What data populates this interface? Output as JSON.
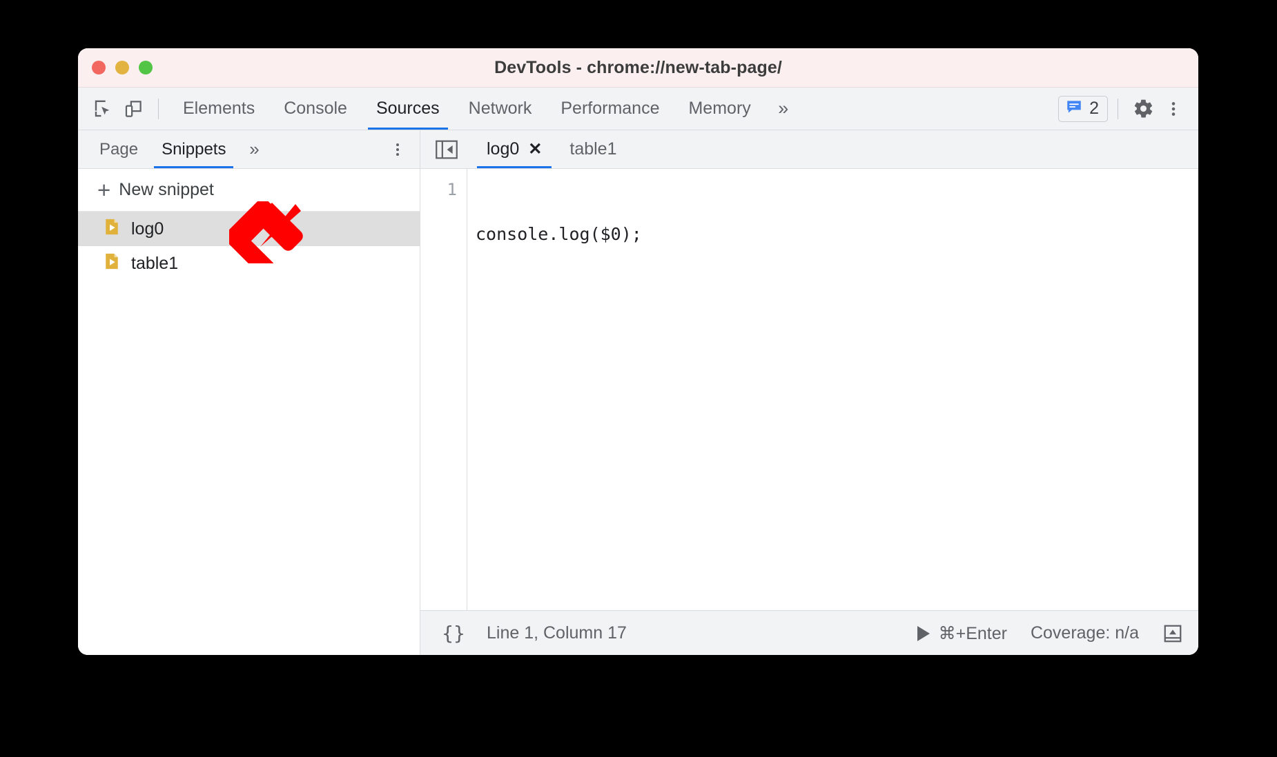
{
  "window": {
    "title": "DevTools - chrome://new-tab-page/",
    "traffic_lights": [
      {
        "name": "close",
        "color": "#f2675f"
      },
      {
        "name": "minimize",
        "color": "#e3b341"
      },
      {
        "name": "zoom",
        "color": "#53c546"
      }
    ]
  },
  "toolbar": {
    "inspect_icon": "inspect-element-icon",
    "device_icon": "device-toolbar-icon",
    "tabs": [
      {
        "label": "Elements",
        "active": false
      },
      {
        "label": "Console",
        "active": false
      },
      {
        "label": "Sources",
        "active": true
      },
      {
        "label": "Network",
        "active": false
      },
      {
        "label": "Performance",
        "active": false
      },
      {
        "label": "Memory",
        "active": false
      }
    ],
    "overflow_label": "»",
    "issues_badge": {
      "icon": "console-message-icon",
      "count": "2",
      "color": "#4285f4"
    },
    "settings_icon": "gear-icon",
    "menu_icon": "kebab-menu-icon"
  },
  "navigator": {
    "tabs": [
      {
        "label": "Page",
        "active": false
      },
      {
        "label": "Snippets",
        "active": true
      }
    ],
    "overflow_label": "»",
    "menu_icon": "kebab-menu-icon",
    "new_snippet": {
      "plus": "+",
      "label": "New snippet"
    },
    "snippets": [
      {
        "label": "log0",
        "icon": "snippet-file-icon",
        "selected": true
      },
      {
        "label": "table1",
        "icon": "snippet-file-icon",
        "selected": false
      }
    ]
  },
  "editor": {
    "collapse_icon": "collapse-sidebar-icon",
    "tabs": [
      {
        "label": "log0",
        "active": true,
        "closable": true,
        "close_glyph": "✕"
      },
      {
        "label": "table1",
        "active": false,
        "closable": false,
        "close_glyph": ""
      }
    ],
    "lines": [
      {
        "number": "1",
        "text": "console.log($0);"
      }
    ]
  },
  "statusbar": {
    "pretty_print_label": "{}",
    "cursor_position": "Line 1, Column 17",
    "run_shortcut": "⌘+Enter",
    "run_icon": "play-icon",
    "coverage": "Coverage: n/a",
    "drawer_icon": "show-drawer-icon"
  },
  "annotation": {
    "arrow": {
      "name": "red-arrow-pointing-down-left",
      "color": "#ff0000",
      "direction": "down-left"
    }
  },
  "colors": {
    "accent": "#1a73e8",
    "titlebar_bg": "#fbf0ef",
    "toolbar_bg": "#f1f3f4",
    "selected_row_bg": "#dedede",
    "snippet_icon": "#e0b23c",
    "annotation_red": "#ff0000"
  }
}
